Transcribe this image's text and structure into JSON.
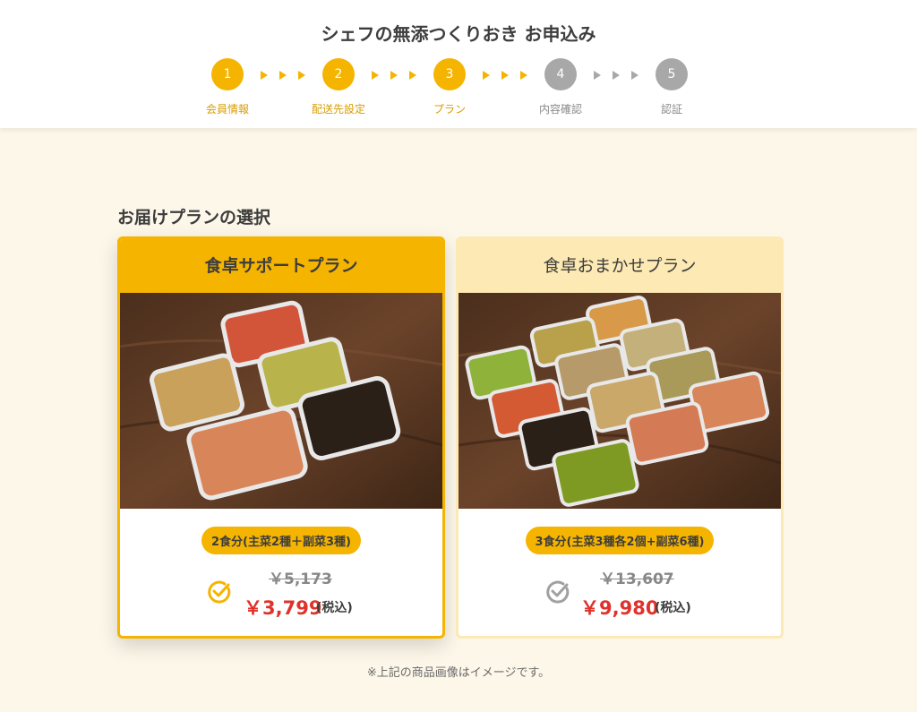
{
  "header": {
    "title": "シェフの無添つくりおき お申込み",
    "steps": [
      {
        "number": "1",
        "label": "会員情報",
        "state": "active"
      },
      {
        "number": "2",
        "label": "配送先設定",
        "state": "active"
      },
      {
        "number": "3",
        "label": "プラン",
        "state": "active"
      },
      {
        "number": "4",
        "label": "内容確認",
        "state": "inactive"
      },
      {
        "number": "5",
        "label": "認証",
        "state": "inactive"
      }
    ]
  },
  "section": {
    "title": "お届けプランの選択"
  },
  "plans": [
    {
      "name": "食卓サポートプラン",
      "portion": "2食分(主菜2種＋副菜3種)",
      "original_price": "￥5,173",
      "price": "￥3,799",
      "tax_label": "(税込)",
      "selected": true,
      "image_icon": "meal-containers-photo"
    },
    {
      "name": "食卓おまかせプラン",
      "portion": "3食分(主菜3種各2個+副菜6種)",
      "original_price": "￥13,607",
      "price": "￥9,980",
      "tax_label": "(税込)",
      "selected": false,
      "image_icon": "meal-containers-photo"
    }
  ],
  "footnote": "※上記の商品画像はイメージです。",
  "colors": {
    "accent": "#f5b400",
    "accent_light": "#fde9b3",
    "price_red": "#e0322b",
    "inactive_gray": "#a8a8a8",
    "background": "#fdf7ea"
  }
}
